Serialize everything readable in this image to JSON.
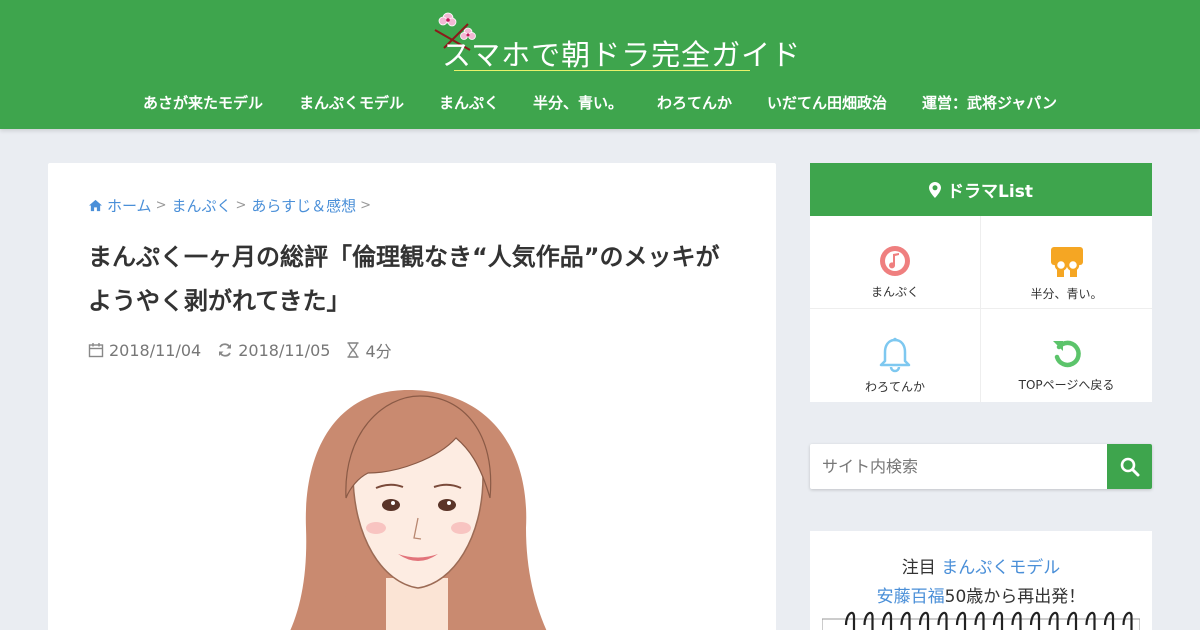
{
  "header": {
    "logo_text": "スマホで朝ドラ完全ガイド",
    "nav": [
      "あさが来たモデル",
      "まんぷくモデル",
      "まんぷく",
      "半分、青い。",
      "わろてんか",
      "いだてん田畑政治",
      "運営：武将ジャパン"
    ]
  },
  "breadcrumb": [
    "ホーム",
    "まんぷく",
    "あらすじ＆感想"
  ],
  "article": {
    "title": "まんぷく一ヶ月の総評「倫理観なき“人気作品”のメッキがようやく剥がれてきた」",
    "published": "2018/11/04",
    "updated": "2018/11/05",
    "read_time": "4分"
  },
  "sidebar": {
    "heading": "ドラマList",
    "items": [
      {
        "label": "まんぷく",
        "icon": "music-disc-icon",
        "color": "#ef7f7f"
      },
      {
        "label": "半分、青い。",
        "icon": "slideshare-icon",
        "color": "#f5a623"
      },
      {
        "label": "わろてんか",
        "icon": "bell-icon",
        "color": "#7ec8f0"
      },
      {
        "label": "TOPページへ戻る",
        "icon": "undo-icon",
        "color": "#5cc46b"
      }
    ],
    "search_placeholder": "サイト内検索",
    "featured": {
      "prefix": "注目",
      "link1": "まんぷくモデル",
      "link2": "安藤百福",
      "suffix": "50歳から再出発！"
    }
  },
  "colors": {
    "brand_green": "#3ea54d",
    "link_blue": "#4a8fd8",
    "background": "#eaedf2"
  }
}
